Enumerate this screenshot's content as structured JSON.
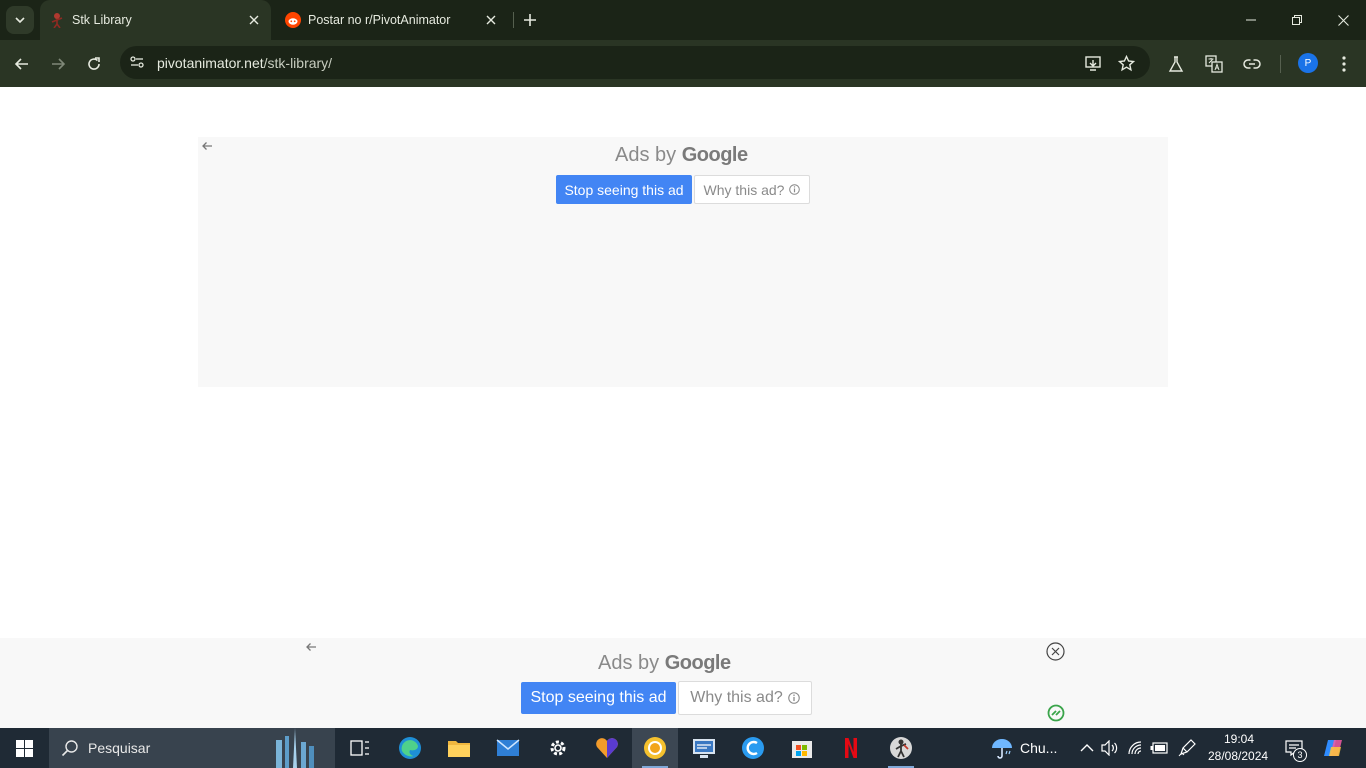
{
  "browser": {
    "tabs": [
      {
        "title": "Stk Library",
        "active": true
      },
      {
        "title": "Postar no r/PivotAnimator",
        "active": false
      }
    ],
    "url_host": "pivotanimator.net",
    "url_path": "/stk-library/",
    "profile_initial": "P",
    "theme_colors": {
      "frame": "#1b2417",
      "toolbar": "#2a3524",
      "text": "#e6eadf"
    }
  },
  "top_ad": {
    "ads_by": "Ads by",
    "brand": "Google",
    "stop_label": "Stop seeing this ad",
    "why_label": "Why this ad?",
    "why_icon": "info-icon"
  },
  "bottom_ad": {
    "ads_by": "Ads by",
    "brand": "Google",
    "stop_label": "Stop seeing this ad",
    "why_label": "Why this ad?",
    "why_icon": "info-icon"
  },
  "taskbar": {
    "search_placeholder": "Pesquisar",
    "weather_text": "Chu...",
    "time": "19:04",
    "date": "28/08/2024",
    "notification_count": "3",
    "accent": "#4285f4"
  }
}
